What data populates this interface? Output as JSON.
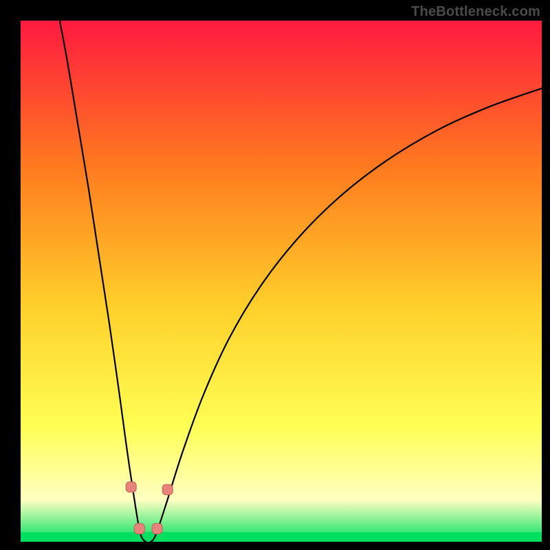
{
  "watermark": "TheBottleneck.com",
  "colors": {
    "background": "#000000",
    "gradient_top": "#ff1a3f",
    "gradient_mid1": "#ff7a1f",
    "gradient_mid2": "#ffd02a",
    "gradient_mid3": "#ffff55",
    "gradient_pale": "#ffffc2",
    "gradient_bottom": "#00e060",
    "curve": "#000000",
    "marker_fill": "#e6837a",
    "marker_stroke": "#c46058"
  },
  "chart_data": {
    "type": "line",
    "title": "",
    "xlabel": "",
    "ylabel": "",
    "x_range": [
      0,
      100
    ],
    "y_range": [
      0,
      100
    ],
    "notch_x": 24,
    "curve_points": [
      {
        "x": 7.5,
        "y": 100.0
      },
      {
        "x": 9.0,
        "y": 92.0
      },
      {
        "x": 11.0,
        "y": 80.0
      },
      {
        "x": 13.0,
        "y": 68.0
      },
      {
        "x": 15.0,
        "y": 55.0
      },
      {
        "x": 17.0,
        "y": 42.0
      },
      {
        "x": 19.0,
        "y": 28.0
      },
      {
        "x": 20.5,
        "y": 17.0
      },
      {
        "x": 22.0,
        "y": 7.0
      },
      {
        "x": 23.0,
        "y": 1.5
      },
      {
        "x": 24.0,
        "y": 0.0
      },
      {
        "x": 25.0,
        "y": 0.0
      },
      {
        "x": 26.0,
        "y": 1.5
      },
      {
        "x": 28.0,
        "y": 7.5
      },
      {
        "x": 31.0,
        "y": 17.0
      },
      {
        "x": 35.0,
        "y": 28.0
      },
      {
        "x": 40.0,
        "y": 39.0
      },
      {
        "x": 46.0,
        "y": 49.0
      },
      {
        "x": 53.0,
        "y": 58.0
      },
      {
        "x": 61.0,
        "y": 66.0
      },
      {
        "x": 70.0,
        "y": 73.0
      },
      {
        "x": 80.0,
        "y": 79.0
      },
      {
        "x": 90.0,
        "y": 83.5
      },
      {
        "x": 100.0,
        "y": 87.0
      }
    ],
    "markers": [
      {
        "x": 21.2,
        "y": 10.5
      },
      {
        "x": 22.8,
        "y": 2.5
      },
      {
        "x": 26.2,
        "y": 2.5
      },
      {
        "x": 28.2,
        "y": 10.0
      }
    ]
  }
}
